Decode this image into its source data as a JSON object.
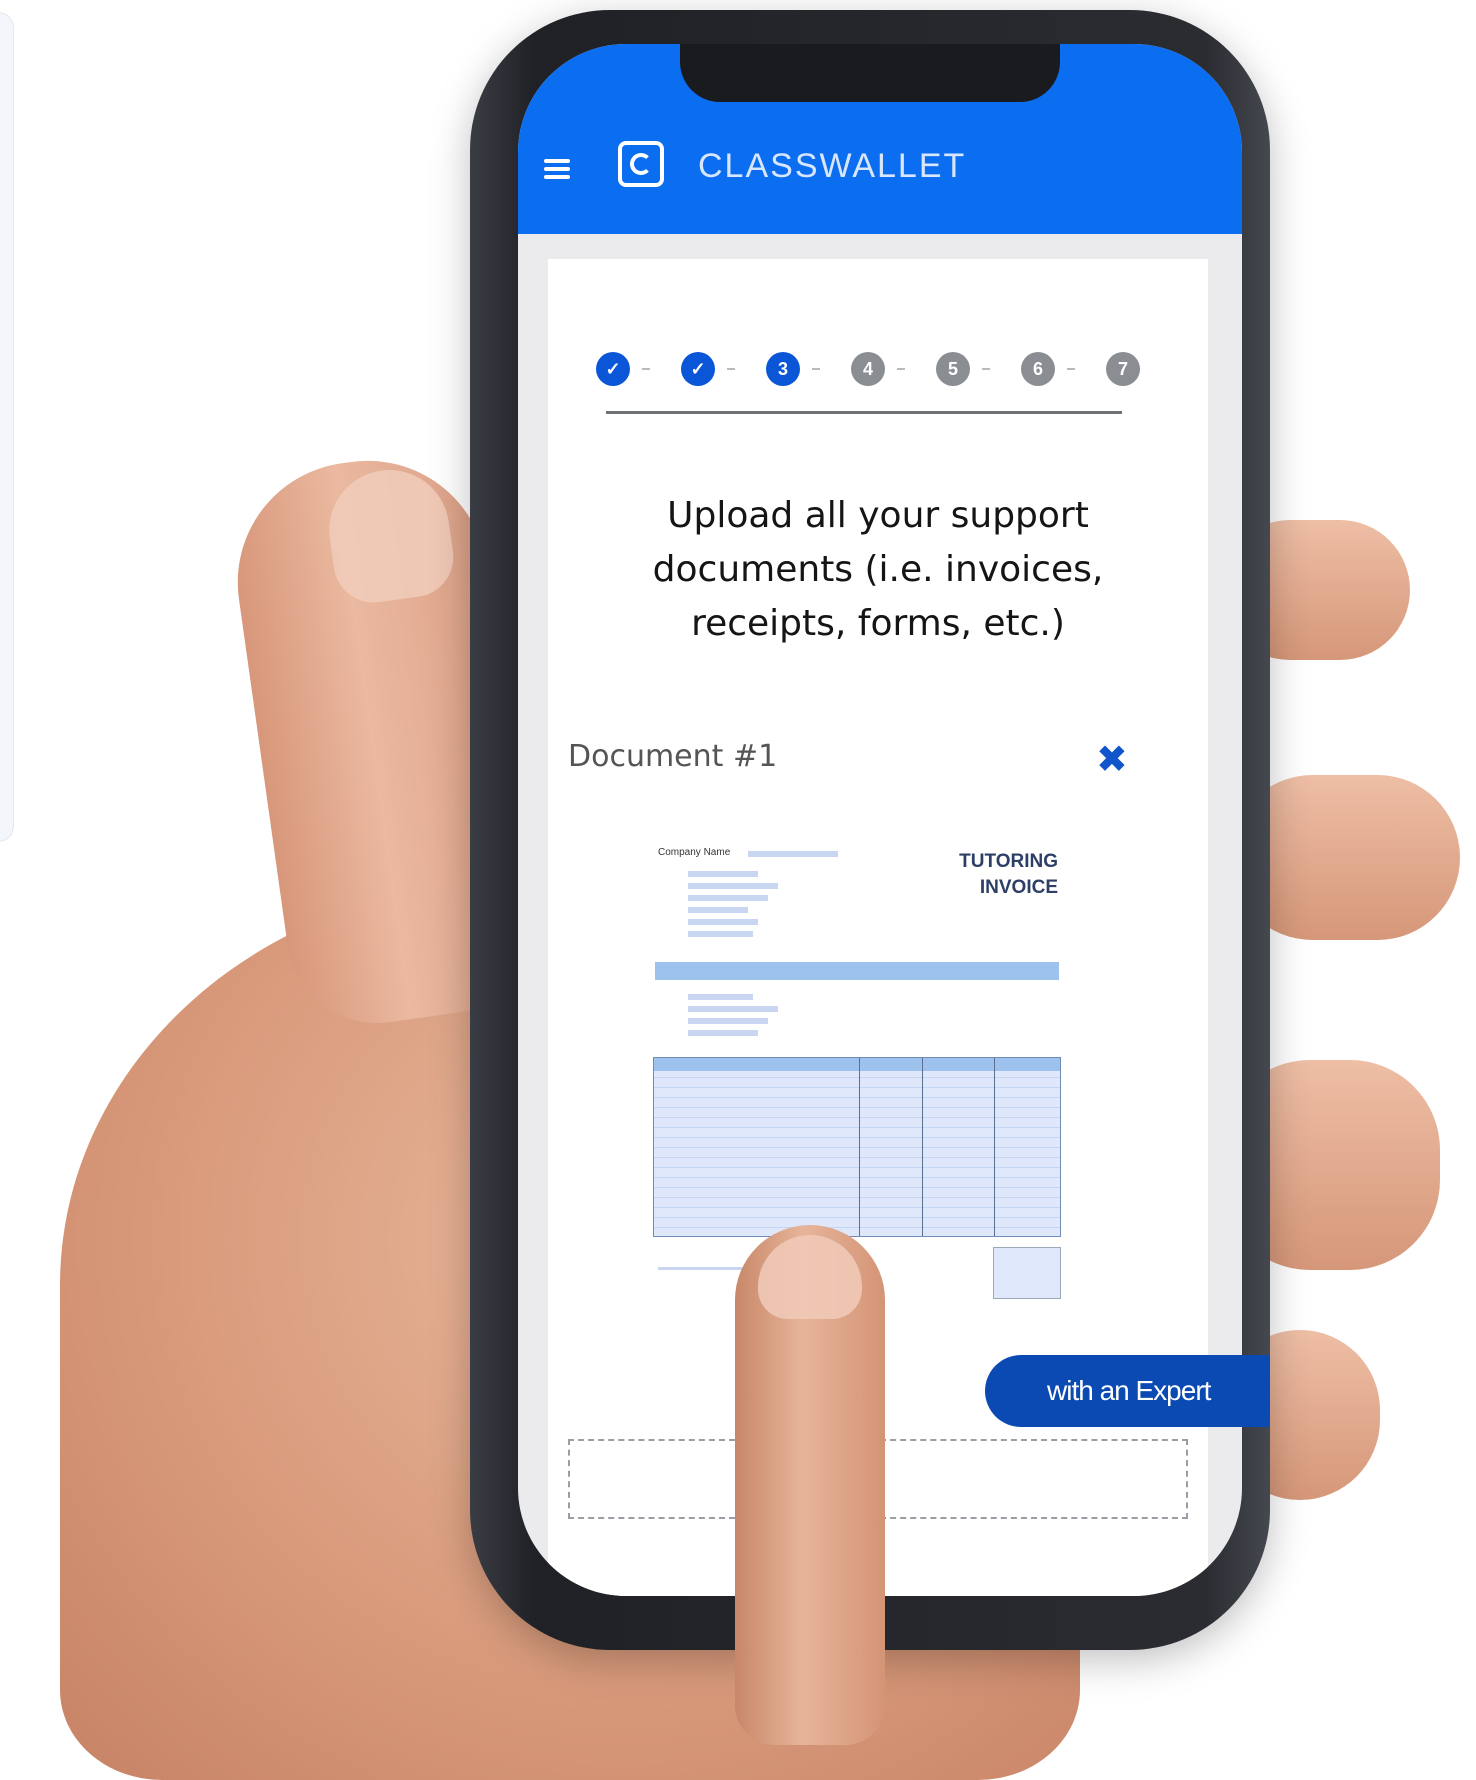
{
  "app": {
    "brand": "CLASSWALLET",
    "menu_icon": "hamburger-menu-icon",
    "logo_icon": "classwallet-logo-icon"
  },
  "steps": [
    {
      "label": "",
      "state": "done"
    },
    {
      "label": "",
      "state": "done"
    },
    {
      "label": "3",
      "state": "current"
    },
    {
      "label": "4",
      "state": "todo"
    },
    {
      "label": "5",
      "state": "todo"
    },
    {
      "label": "6",
      "state": "todo"
    },
    {
      "label": "7",
      "state": "todo"
    }
  ],
  "main": {
    "headline_line1": "Upload all your support",
    "headline_line2": "documents (i.e. invoices,",
    "headline_line3": "receipts, forms, etc.)",
    "document_label": "Document #1",
    "remove_icon": "close-icon"
  },
  "invoice": {
    "title_line1": "TUTORING",
    "title_line2": "INVOICE",
    "company_label": "Company Name"
  },
  "chat": {
    "button_label": "with an Expert"
  },
  "colors": {
    "accent": "#0b6ef0",
    "step_active": "#0b56d6",
    "step_inactive": "#8a8d92",
    "button": "#0b4ab3"
  }
}
